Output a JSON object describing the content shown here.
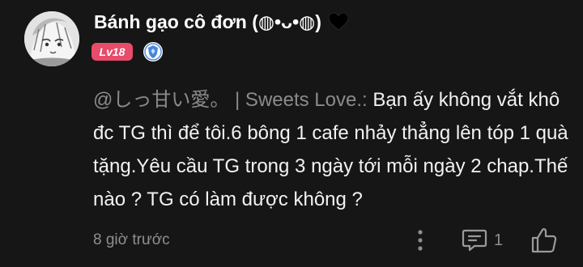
{
  "user": {
    "name": "Bánh gạo cô đơn (◍•ᴗ•◍)",
    "heart_icon": "black-heart-icon",
    "level": "Lv18",
    "member_icon": "shield-member-icon",
    "avatar_icon": "anime-avatar"
  },
  "comment": {
    "mention": "@しっ甘い愛。 | Sweets Love.:",
    "body": "Bạn ấy không vắt khô đc TG thì để tôi.6 bông 1 cafe nhảy thẳng lên tóp 1 quà tặng.Yêu cầu TG trong 3 ngày tới mỗi ngày 2 chap.Thế nào ? TG có làm được không ?"
  },
  "footer": {
    "time": "8 giờ trước",
    "more_icon": "more-vertical-icon",
    "reply_icon": "comment-icon",
    "reply_count": "1",
    "like_icon": "thumbs-up-icon"
  },
  "colors": {
    "background": "#161616",
    "level_badge": "#e94b6a",
    "muted_text": "#8f8f8f"
  }
}
